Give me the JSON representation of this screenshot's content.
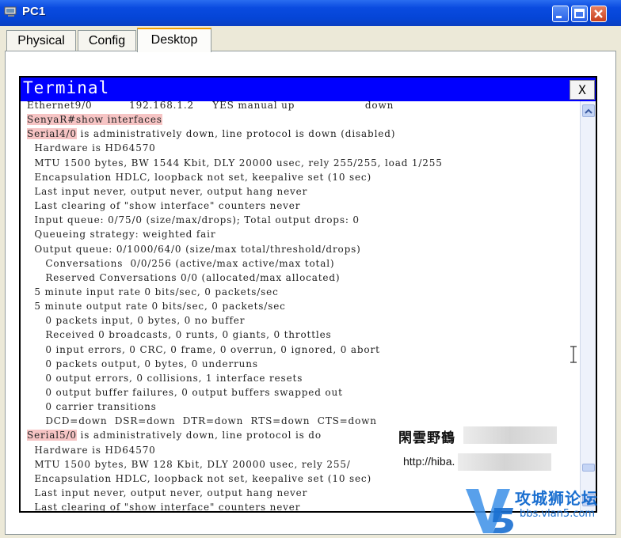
{
  "window": {
    "title": "PC1",
    "minimize_icon": "minimize-icon",
    "maximize_icon": "maximize-icon",
    "close_icon": "close-icon"
  },
  "tabs": [
    {
      "label": "Physical",
      "active": false
    },
    {
      "label": "Config",
      "active": false
    },
    {
      "label": "Desktop",
      "active": true
    }
  ],
  "terminal": {
    "title": "Terminal",
    "close_label": "X",
    "lines": [
      {
        "text": "Ethernet9/0          192.168.1.2     YES manual up                   down",
        "hl": null
      },
      {
        "text": "SenyaR#show interfaces",
        "hl": "full"
      },
      {
        "text": "Serial4/0 is administratively down, line protocol is down (disabled)",
        "hl": "Serial4/0"
      },
      {
        "text": "  Hardware is HD64570",
        "hl": null
      },
      {
        "text": "  MTU 1500 bytes, BW 1544 Kbit, DLY 20000 usec, rely 255/255, load 1/255",
        "hl": null
      },
      {
        "text": "  Encapsulation HDLC, loopback not set, keepalive set (10 sec)",
        "hl": null
      },
      {
        "text": "  Last input never, output never, output hang never",
        "hl": null
      },
      {
        "text": "  Last clearing of \"show interface\" counters never",
        "hl": null
      },
      {
        "text": "  Input queue: 0/75/0 (size/max/drops); Total output drops: 0",
        "hl": null
      },
      {
        "text": "  Queueing strategy: weighted fair",
        "hl": null
      },
      {
        "text": "  Output queue: 0/1000/64/0 (size/max total/threshold/drops)",
        "hl": null
      },
      {
        "text": "     Conversations  0/0/256 (active/max active/max total)",
        "hl": null
      },
      {
        "text": "     Reserved Conversations 0/0 (allocated/max allocated)",
        "hl": null
      },
      {
        "text": "  5 minute input rate 0 bits/sec, 0 packets/sec",
        "hl": null
      },
      {
        "text": "  5 minute output rate 0 bits/sec, 0 packets/sec",
        "hl": null
      },
      {
        "text": "     0 packets input, 0 bytes, 0 no buffer",
        "hl": null
      },
      {
        "text": "     Received 0 broadcasts, 0 runts, 0 giants, 0 throttles",
        "hl": null
      },
      {
        "text": "     0 input errors, 0 CRC, 0 frame, 0 overrun, 0 ignored, 0 abort",
        "hl": null
      },
      {
        "text": "     0 packets output, 0 bytes, 0 underruns",
        "hl": null
      },
      {
        "text": "     0 output errors, 0 collisions, 1 interface resets",
        "hl": null
      },
      {
        "text": "     0 output buffer failures, 0 output buffers swapped out",
        "hl": null
      },
      {
        "text": "     0 carrier transitions",
        "hl": null
      },
      {
        "text": "     DCD=down  DSR=down  DTR=down  RTS=down  CTS=down",
        "hl": null
      },
      {
        "text": "Serial5/0 is administratively down, line protocol is do",
        "hl": "Serial5/0"
      },
      {
        "text": "  Hardware is HD64570",
        "hl": null
      },
      {
        "text": "  MTU 1500 bytes, BW 128 Kbit, DLY 20000 usec, rely 255/",
        "hl": null
      },
      {
        "text": "  Encapsulation HDLC, loopback not set, keepalive set (10 sec)",
        "hl": null
      },
      {
        "text": "  Last input never, output never, output hang never",
        "hl": null
      },
      {
        "text": "  Last clearing of \"show interface\" counters never",
        "hl": null
      }
    ],
    "scroll_up_icon": "scroll-up-arrow-icon",
    "scroll_down_icon": "scroll-down-arrow-icon"
  },
  "watermark": {
    "overlay_cn": "閑雲野鶴",
    "overlay_url": "http://hiba.",
    "logo_cn": "攻城狮论坛",
    "logo_url": "bbs.vlan5.com"
  }
}
